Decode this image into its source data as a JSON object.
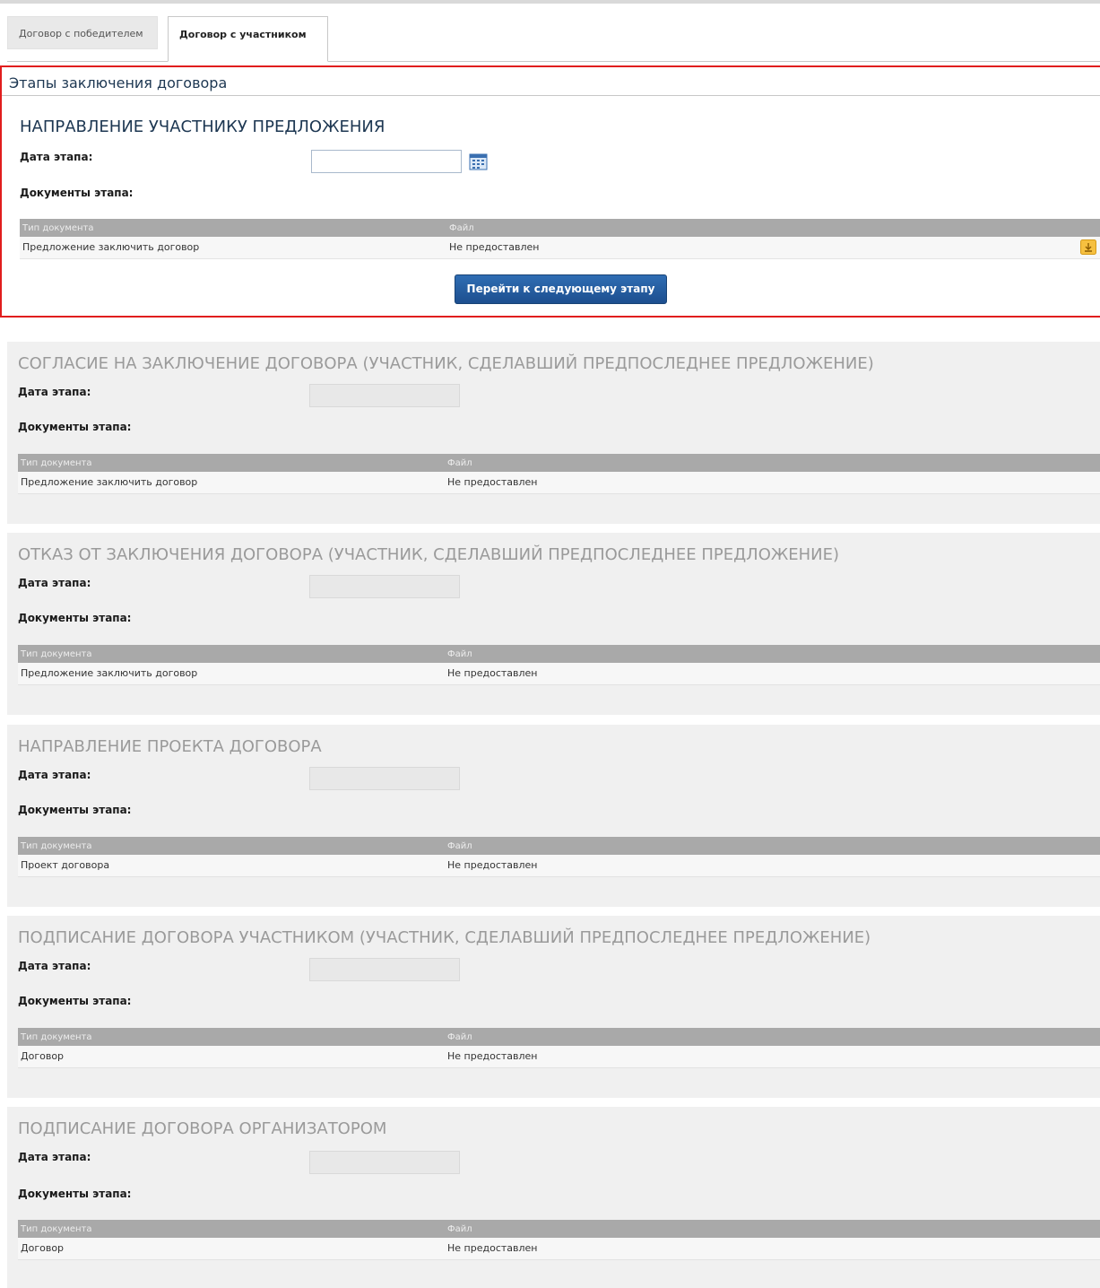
{
  "tabs": [
    {
      "label": "Договор с победителем",
      "active": false
    },
    {
      "label": "Договор с участником",
      "active": true
    }
  ],
  "stages_title": "Этапы заключения договора",
  "labels": {
    "date": "Дата этапа:",
    "docs": "Документы этапа:",
    "col_type": "Тип документа",
    "col_file": "Файл"
  },
  "active_stage": {
    "title": "НАПРАВЛЕНИЕ УЧАСТНИКУ ПРЕДЛОЖЕНИЯ",
    "date_value": "",
    "doc_type": "Предложение заключить договор",
    "file": "Не предоставлен",
    "next_button": "Перейти к следующему этапу"
  },
  "stages": [
    {
      "title": "СОГЛАСИЕ НА ЗАКЛЮЧЕНИЕ ДОГОВОРА (УЧАСТНИК, СДЕЛАВШИЙ ПРЕДПОСЛЕДНЕЕ ПРЕДЛОЖЕНИЕ)",
      "doc_type": "Предложение заключить договор",
      "file": "Не предоставлен"
    },
    {
      "title": "ОТКАЗ ОТ ЗАКЛЮЧЕНИЯ ДОГОВОРА (УЧАСТНИК, СДЕЛАВШИЙ ПРЕДПОСЛЕДНЕЕ ПРЕДЛОЖЕНИЕ)",
      "doc_type": "Предложение заключить договор",
      "file": "Не предоставлен"
    },
    {
      "title": "НАПРАВЛЕНИЕ ПРОЕКТА ДОГОВОРА",
      "doc_type": "Проект договора",
      "file": "Не предоставлен"
    },
    {
      "title": "ПОДПИСАНИЕ ДОГОВОРА УЧАСТНИКОМ (УЧАСТНИК, СДЕЛАВШИЙ ПРЕДПОСЛЕДНЕЕ ПРЕДЛОЖЕНИЕ)",
      "doc_type": "Договор",
      "file": "Не предоставлен"
    },
    {
      "title": "ПОДПИСАНИЕ ДОГОВОРА ОРГАНИЗАТОРОМ",
      "doc_type": "Договор",
      "file": "Не предоставлен"
    }
  ],
  "icons": {
    "calendar": "calendar-icon",
    "upload": "upload-icon"
  },
  "colors": {
    "accent": "#1d3752",
    "highlight_border": "#e11d1d",
    "button": "#2f6db3"
  }
}
